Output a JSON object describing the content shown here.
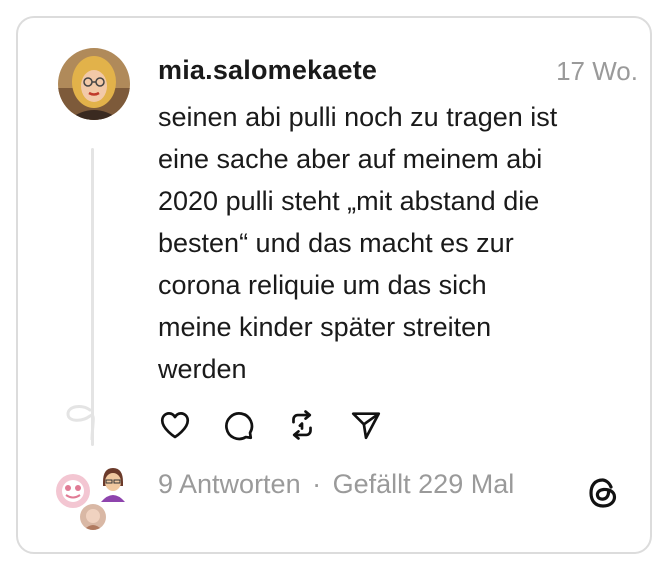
{
  "post": {
    "username": "mia.salomekaete",
    "timestamp": "17 Wo.",
    "text": "seinen abi pulli noch zu tragen ist\neine sache aber auf meinem abi\n2020 pulli steht „mit abstand die\nbesten“ und das macht es zur\ncorona reliquie um das sich\nmeine kinder später streiten\nwerden"
  },
  "stats": {
    "replies": "9 Antworten",
    "separator": "·",
    "likes": "Gefällt 229 Mal"
  },
  "icons": {
    "like": "heart-icon",
    "reply": "comment-icon",
    "repost": "repost-icon",
    "share": "send-icon",
    "brand": "threads-logo"
  },
  "colors": {
    "text": "#1a1a1a",
    "muted": "#9a9a9a",
    "border": "#dcdcdc"
  }
}
